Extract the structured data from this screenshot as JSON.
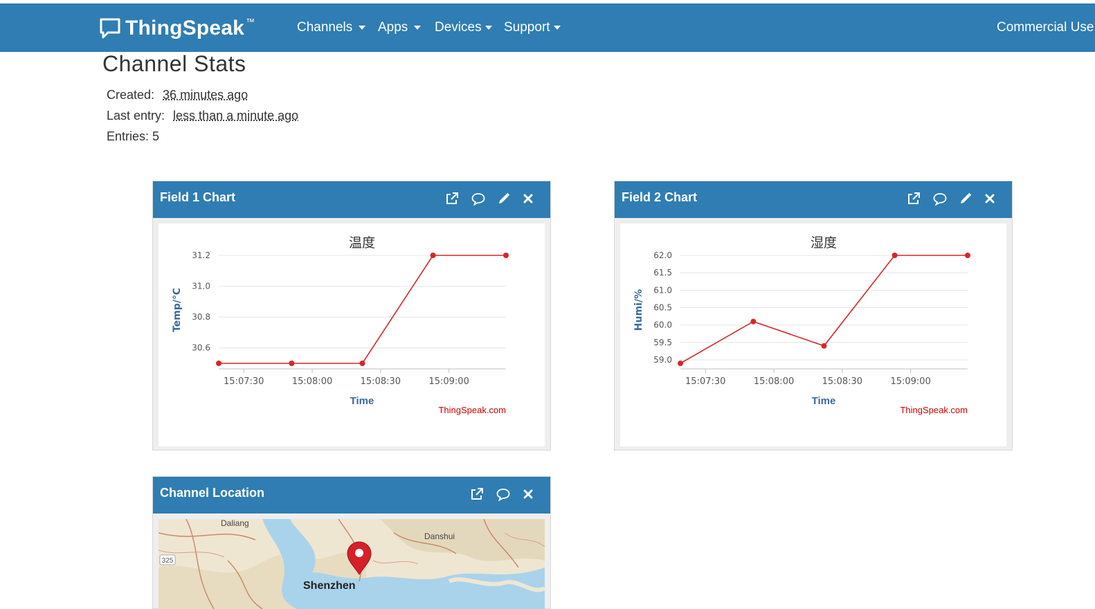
{
  "brand": {
    "name": "ThingSpeak",
    "tm": "™"
  },
  "nav": {
    "items": [
      {
        "label": "Channels"
      },
      {
        "label": "Apps"
      },
      {
        "label": "Devices"
      },
      {
        "label": "Support"
      }
    ],
    "commercial": "Commercial Use"
  },
  "stats": {
    "title": "Channel Stats",
    "created_label": "Created:",
    "created_value": "36 minutes ago",
    "last_entry_label": "Last entry:",
    "last_entry_value": "less than a minute ago",
    "entries_label": "Entries:",
    "entries_value": "5"
  },
  "panels": {
    "field1": {
      "title": "Field 1 Chart"
    },
    "field2": {
      "title": "Field 2 Chart"
    },
    "location": {
      "title": "Channel Location"
    }
  },
  "map": {
    "labels": [
      "Daliang",
      "Danshui",
      "Shenzhen",
      "325"
    ]
  },
  "colors": {
    "accent": "#2f7db2",
    "series": "#d62728",
    "credit": "#cc0000"
  },
  "chart_data": [
    {
      "type": "line",
      "title": "温度",
      "xlabel": "Time",
      "ylabel": "Temp/℃",
      "credit": "ThingSpeak.com",
      "x": [
        "15:07:19",
        "15:07:51",
        "15:08:22",
        "15:08:53",
        "15:09:25"
      ],
      "x_ticks": [
        "15:07:30",
        "15:08:00",
        "15:08:30",
        "15:09:00"
      ],
      "y_ticks": [
        "30.6",
        "30.8",
        "31.0",
        "31.2"
      ],
      "values": [
        30.5,
        30.5,
        30.5,
        31.2,
        31.2
      ],
      "ylim": [
        30.5,
        31.2
      ],
      "grid": true
    },
    {
      "type": "line",
      "title": "湿度",
      "xlabel": "Time",
      "ylabel": "Humi/%",
      "credit": "ThingSpeak.com",
      "x": [
        "15:07:19",
        "15:07:51",
        "15:08:22",
        "15:08:53",
        "15:09:25"
      ],
      "x_ticks": [
        "15:07:30",
        "15:08:00",
        "15:08:30",
        "15:09:00"
      ],
      "y_ticks": [
        "59.0",
        "59.5",
        "60.0",
        "60.5",
        "61.0",
        "61.5",
        "62.0"
      ],
      "values": [
        58.9,
        60.1,
        59.4,
        62.0,
        62.0
      ],
      "ylim": [
        58.9,
        62.0
      ],
      "grid": true
    }
  ]
}
